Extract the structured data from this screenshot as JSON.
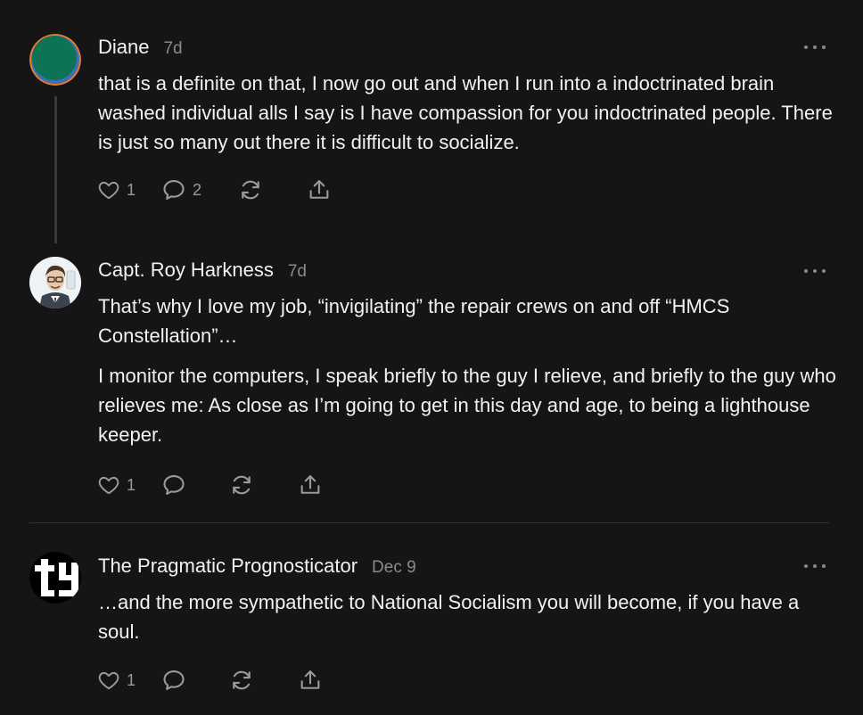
{
  "comments": [
    {
      "author": "Diane",
      "time": "7d",
      "paragraphs": [
        "that is a definite on that, I now go out and when I run into a indoctrinated brain washed individual alls I say is I have compassion for you indoctrinated people. There is just so many out there it is difficult to socialize."
      ],
      "likes": "1",
      "replies": "2"
    },
    {
      "author": "Capt. Roy Harkness",
      "time": "7d",
      "paragraphs": [
        "That’s why I love my job, “invigilating” the repair crews on and off “HMCS Constellation”…",
        "I monitor the computers, I speak briefly to the guy I relieve, and briefly to the guy who relieves me: As close as I’m going to get in this day and age, to being a lighthouse keeper."
      ],
      "likes": "1",
      "replies": ""
    },
    {
      "author": "The Pragmatic Prognosticator",
      "time": "Dec 9",
      "paragraphs": [
        "…and the more sympathetic to National Socialism you will become, if you have a soul."
      ],
      "likes": "1",
      "replies": ""
    }
  ],
  "icons": {
    "like": "heart-icon",
    "reply": "speech-bubble-icon",
    "restack": "restack-icon",
    "share": "share-icon",
    "more": "more-options-icon"
  }
}
